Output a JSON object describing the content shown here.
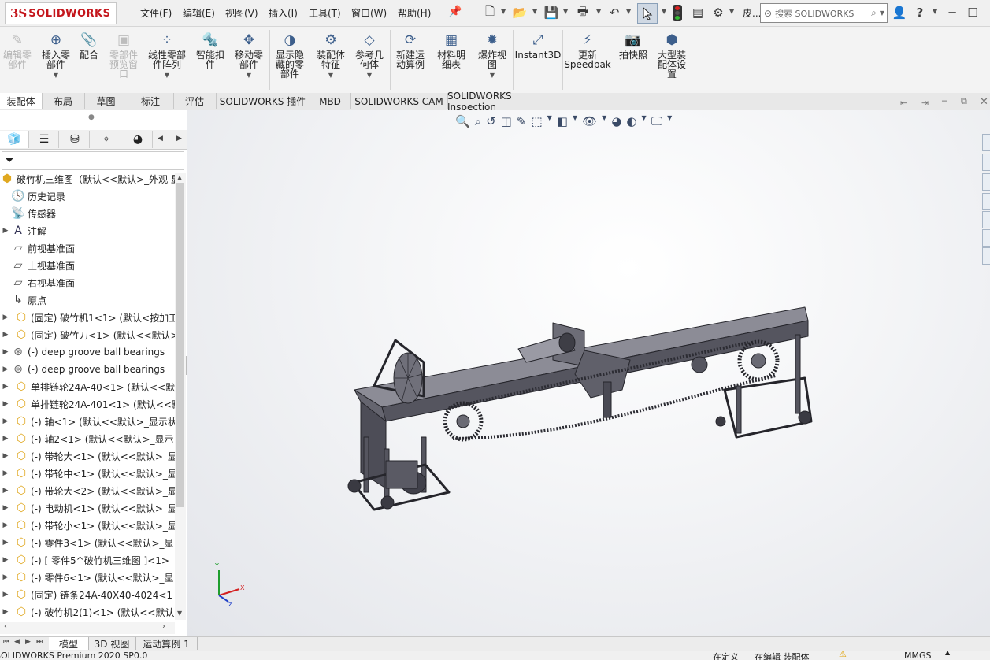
{
  "app": {
    "brand_ds": "3S",
    "brand_name": "SOLIDWORKS"
  },
  "menu": [
    "文件(F)",
    "编辑(E)",
    "视图(V)",
    "插入(I)",
    "工具(T)",
    "窗口(W)",
    "帮助(H)"
  ],
  "search": {
    "placeholder": "搜索 SOLIDWORKS",
    "truncated_label": "皮..."
  },
  "commands": [
    {
      "label": "编辑零\n部件",
      "icon": "edit-component-icon",
      "enabled": false
    },
    {
      "label": "插入零\n部件",
      "icon": "insert-component-icon",
      "enabled": true
    },
    {
      "label": "配合",
      "icon": "mate-icon",
      "enabled": true
    },
    {
      "label": "零部件\n预览窗\n口",
      "icon": "component-preview-icon",
      "enabled": false
    },
    {
      "label": "线性零部\n件阵列",
      "icon": "linear-pattern-icon",
      "enabled": true
    },
    {
      "label": "智能扣\n件",
      "icon": "smart-fastener-icon",
      "enabled": true
    },
    {
      "label": "移动零\n部件",
      "icon": "move-component-icon",
      "enabled": true
    },
    {
      "label": "显示隐\n藏的零\n部件",
      "icon": "show-hidden-icon",
      "enabled": true
    },
    {
      "label": "装配体\n特征",
      "icon": "assembly-feature-icon",
      "enabled": true
    },
    {
      "label": "参考几\n何体",
      "icon": "reference-geometry-icon",
      "enabled": true
    },
    {
      "label": "新建运\n动算例",
      "icon": "motion-study-icon",
      "enabled": true
    },
    {
      "label": "材料明\n细表",
      "icon": "bom-icon",
      "enabled": true
    },
    {
      "label": "爆炸视\n图",
      "icon": "exploded-view-icon",
      "enabled": true
    },
    {
      "label": "Instant3D",
      "icon": "instant3d-icon",
      "enabled": true
    },
    {
      "label": "更新\nSpeedpak",
      "icon": "speedpak-icon",
      "enabled": true
    },
    {
      "label": "拍快照",
      "icon": "snapshot-icon",
      "enabled": true
    },
    {
      "label": "大型装\n配体设\n置",
      "icon": "large-assembly-icon",
      "enabled": true
    }
  ],
  "tabs": [
    "装配体",
    "布局",
    "草图",
    "标注",
    "评估",
    "SOLIDWORKS 插件",
    "MBD",
    "SOLIDWORKS CAM",
    "SOLIDWORKS Inspection"
  ],
  "tree": {
    "root": "破竹机三维图（默认<<默认>_外观 显",
    "items": [
      {
        "label": "历史记录",
        "icon": "history-icon",
        "expand": false
      },
      {
        "label": "传感器",
        "icon": "sensor-icon",
        "expand": false
      },
      {
        "label": "注解",
        "icon": "annotation-icon",
        "expand": true
      },
      {
        "label": "前视基准面",
        "icon": "plane-icon",
        "expand": false
      },
      {
        "label": "上视基准面",
        "icon": "plane-icon",
        "expand": false
      },
      {
        "label": "右视基准面",
        "icon": "plane-icon",
        "expand": false
      },
      {
        "label": "原点",
        "icon": "origin-icon",
        "expand": false
      },
      {
        "label": "(固定) 破竹机1<1> (默认<按加工",
        "icon": "part-icon",
        "expand": true
      },
      {
        "label": "(固定) 破竹刀<1> (默认<<默认>_",
        "icon": "part-icon",
        "expand": true
      },
      {
        "label": "(-) deep groove ball bearings",
        "icon": "bearing-icon",
        "expand": true
      },
      {
        "label": "(-) deep groove ball bearings",
        "icon": "bearing-icon",
        "expand": true
      },
      {
        "label": "单排链轮24A-40<1> (默认<<默",
        "icon": "part-icon",
        "expand": true
      },
      {
        "label": "单排链轮24A-401<1> (默认<<默",
        "icon": "part-icon",
        "expand": true
      },
      {
        "label": "(-) 轴<1> (默认<<默认>_显示状",
        "icon": "part-icon",
        "expand": true
      },
      {
        "label": "(-) 轴2<1> (默认<<默认>_显示",
        "icon": "part-icon",
        "expand": true
      },
      {
        "label": "(-) 带轮大<1> (默认<<默认>_显",
        "icon": "part-icon",
        "expand": true
      },
      {
        "label": "(-) 带轮中<1> (默认<<默认>_显",
        "icon": "part-icon",
        "expand": true
      },
      {
        "label": "(-) 带轮大<2> (默认<<默认>_显",
        "icon": "part-icon",
        "expand": true
      },
      {
        "label": "(-) 电动机<1> (默认<<默认>_显",
        "icon": "part-icon",
        "expand": true
      },
      {
        "label": "(-) 带轮小<1> (默认<<默认>_显",
        "icon": "part-icon",
        "expand": true
      },
      {
        "label": "(-) 零件3<1> (默认<<默认>_显",
        "icon": "part-icon",
        "expand": true
      },
      {
        "label": "(-) [ 零件5^破竹机三维图 ]<1>",
        "icon": "part-icon",
        "expand": true
      },
      {
        "label": "(-) 零件6<1> (默认<<默认>_显",
        "icon": "part-icon",
        "expand": true
      },
      {
        "label": "(固定) 链条24A-40X40-4024<1",
        "icon": "part-icon",
        "expand": true
      },
      {
        "label": "(-) 破竹机2(1)<1> (默认<<默认",
        "icon": "part-icon",
        "expand": true
      }
    ]
  },
  "bottom_tabs": [
    "模型",
    "3D 视图",
    "运动算例 1"
  ],
  "status": {
    "left": "SOLIDWORKS Premium 2020 SP0.0",
    "custom": "在定义",
    "editing": "在编辑 装配体",
    "units": "MMGS"
  },
  "triad": {
    "x": "X",
    "y": "Y",
    "z": "Z"
  },
  "colors": {
    "brand_red": "#c4161c",
    "model_gray": "#5c5c66",
    "part_yellow": "#e0b020"
  }
}
